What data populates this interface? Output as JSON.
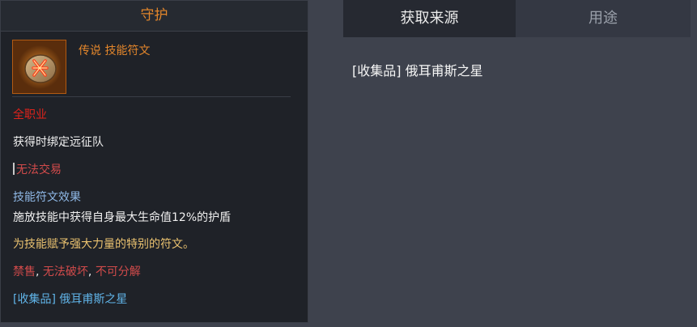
{
  "tooltip": {
    "header": "守护",
    "item": {
      "icon": "rune-icon",
      "name": "传说 技能符文"
    },
    "class_restriction": "全职业",
    "binding": "获得时绑定远征队",
    "trade": "无法交易",
    "effect_title": "技能符文效果",
    "effect_desc": "施放技能中获得自身最大生命值12%的护盾",
    "flavor": "为技能赋予强大力量的特别的符文。",
    "restrictions": [
      "禁售",
      "无法破坏",
      "不可分解"
    ],
    "source": "[收集品] 俄耳甫斯之星"
  },
  "tabs": [
    {
      "label": "获取来源",
      "active": true
    },
    {
      "label": "用途",
      "active": false
    }
  ],
  "sources": [
    "[收集品] 俄耳甫斯之星"
  ],
  "colors": {
    "legendary": "#e3862b",
    "warning": "#e0231b",
    "restricted": "#d24b4b",
    "effect": "#8fb8e6",
    "flavor": "#e9c16f",
    "link": "#60b4e8"
  }
}
